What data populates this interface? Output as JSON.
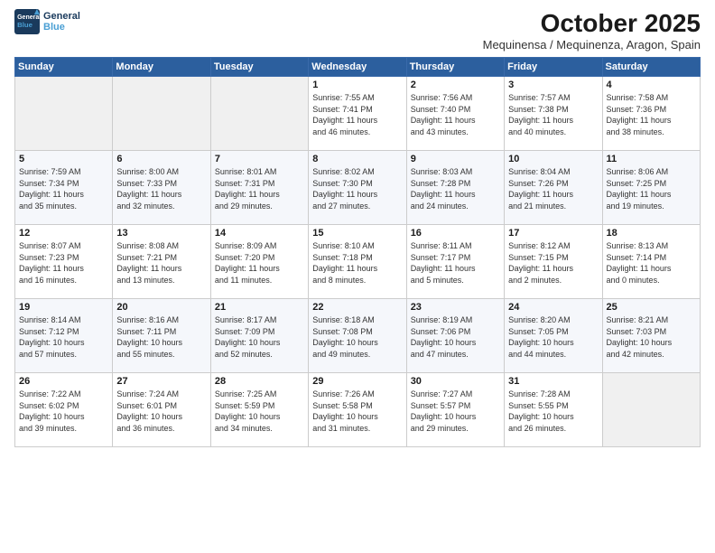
{
  "header": {
    "logo_line1": "General",
    "logo_line2": "Blue",
    "month": "October 2025",
    "location": "Mequinensa / Mequinenza, Aragon, Spain"
  },
  "weekdays": [
    "Sunday",
    "Monday",
    "Tuesday",
    "Wednesday",
    "Thursday",
    "Friday",
    "Saturday"
  ],
  "weeks": [
    [
      {
        "day": "",
        "info": ""
      },
      {
        "day": "",
        "info": ""
      },
      {
        "day": "",
        "info": ""
      },
      {
        "day": "1",
        "info": "Sunrise: 7:55 AM\nSunset: 7:41 PM\nDaylight: 11 hours\nand 46 minutes."
      },
      {
        "day": "2",
        "info": "Sunrise: 7:56 AM\nSunset: 7:40 PM\nDaylight: 11 hours\nand 43 minutes."
      },
      {
        "day": "3",
        "info": "Sunrise: 7:57 AM\nSunset: 7:38 PM\nDaylight: 11 hours\nand 40 minutes."
      },
      {
        "day": "4",
        "info": "Sunrise: 7:58 AM\nSunset: 7:36 PM\nDaylight: 11 hours\nand 38 minutes."
      }
    ],
    [
      {
        "day": "5",
        "info": "Sunrise: 7:59 AM\nSunset: 7:34 PM\nDaylight: 11 hours\nand 35 minutes."
      },
      {
        "day": "6",
        "info": "Sunrise: 8:00 AM\nSunset: 7:33 PM\nDaylight: 11 hours\nand 32 minutes."
      },
      {
        "day": "7",
        "info": "Sunrise: 8:01 AM\nSunset: 7:31 PM\nDaylight: 11 hours\nand 29 minutes."
      },
      {
        "day": "8",
        "info": "Sunrise: 8:02 AM\nSunset: 7:30 PM\nDaylight: 11 hours\nand 27 minutes."
      },
      {
        "day": "9",
        "info": "Sunrise: 8:03 AM\nSunset: 7:28 PM\nDaylight: 11 hours\nand 24 minutes."
      },
      {
        "day": "10",
        "info": "Sunrise: 8:04 AM\nSunset: 7:26 PM\nDaylight: 11 hours\nand 21 minutes."
      },
      {
        "day": "11",
        "info": "Sunrise: 8:06 AM\nSunset: 7:25 PM\nDaylight: 11 hours\nand 19 minutes."
      }
    ],
    [
      {
        "day": "12",
        "info": "Sunrise: 8:07 AM\nSunset: 7:23 PM\nDaylight: 11 hours\nand 16 minutes."
      },
      {
        "day": "13",
        "info": "Sunrise: 8:08 AM\nSunset: 7:21 PM\nDaylight: 11 hours\nand 13 minutes."
      },
      {
        "day": "14",
        "info": "Sunrise: 8:09 AM\nSunset: 7:20 PM\nDaylight: 11 hours\nand 11 minutes."
      },
      {
        "day": "15",
        "info": "Sunrise: 8:10 AM\nSunset: 7:18 PM\nDaylight: 11 hours\nand 8 minutes."
      },
      {
        "day": "16",
        "info": "Sunrise: 8:11 AM\nSunset: 7:17 PM\nDaylight: 11 hours\nand 5 minutes."
      },
      {
        "day": "17",
        "info": "Sunrise: 8:12 AM\nSunset: 7:15 PM\nDaylight: 11 hours\nand 2 minutes."
      },
      {
        "day": "18",
        "info": "Sunrise: 8:13 AM\nSunset: 7:14 PM\nDaylight: 11 hours\nand 0 minutes."
      }
    ],
    [
      {
        "day": "19",
        "info": "Sunrise: 8:14 AM\nSunset: 7:12 PM\nDaylight: 10 hours\nand 57 minutes."
      },
      {
        "day": "20",
        "info": "Sunrise: 8:16 AM\nSunset: 7:11 PM\nDaylight: 10 hours\nand 55 minutes."
      },
      {
        "day": "21",
        "info": "Sunrise: 8:17 AM\nSunset: 7:09 PM\nDaylight: 10 hours\nand 52 minutes."
      },
      {
        "day": "22",
        "info": "Sunrise: 8:18 AM\nSunset: 7:08 PM\nDaylight: 10 hours\nand 49 minutes."
      },
      {
        "day": "23",
        "info": "Sunrise: 8:19 AM\nSunset: 7:06 PM\nDaylight: 10 hours\nand 47 minutes."
      },
      {
        "day": "24",
        "info": "Sunrise: 8:20 AM\nSunset: 7:05 PM\nDaylight: 10 hours\nand 44 minutes."
      },
      {
        "day": "25",
        "info": "Sunrise: 8:21 AM\nSunset: 7:03 PM\nDaylight: 10 hours\nand 42 minutes."
      }
    ],
    [
      {
        "day": "26",
        "info": "Sunrise: 7:22 AM\nSunset: 6:02 PM\nDaylight: 10 hours\nand 39 minutes."
      },
      {
        "day": "27",
        "info": "Sunrise: 7:24 AM\nSunset: 6:01 PM\nDaylight: 10 hours\nand 36 minutes."
      },
      {
        "day": "28",
        "info": "Sunrise: 7:25 AM\nSunset: 5:59 PM\nDaylight: 10 hours\nand 34 minutes."
      },
      {
        "day": "29",
        "info": "Sunrise: 7:26 AM\nSunset: 5:58 PM\nDaylight: 10 hours\nand 31 minutes."
      },
      {
        "day": "30",
        "info": "Sunrise: 7:27 AM\nSunset: 5:57 PM\nDaylight: 10 hours\nand 29 minutes."
      },
      {
        "day": "31",
        "info": "Sunrise: 7:28 AM\nSunset: 5:55 PM\nDaylight: 10 hours\nand 26 minutes."
      },
      {
        "day": "",
        "info": ""
      }
    ]
  ]
}
